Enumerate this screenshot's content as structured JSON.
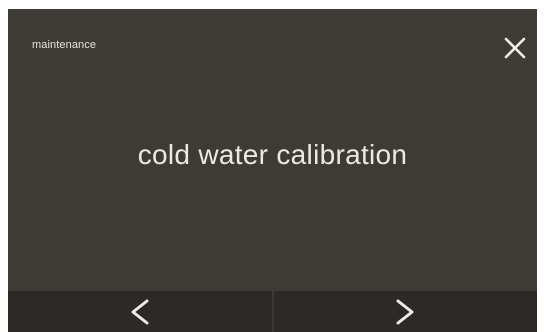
{
  "header": {
    "title": "maintenance",
    "close_icon": "close-icon"
  },
  "main": {
    "title": "cold water calibration"
  },
  "navigation": {
    "previous_icon": "chevron-left-icon",
    "next_icon": "chevron-right-icon"
  },
  "colors": {
    "background": "#3e3a36",
    "nav_bar": "#2c2927",
    "text": "#ece8e2"
  }
}
